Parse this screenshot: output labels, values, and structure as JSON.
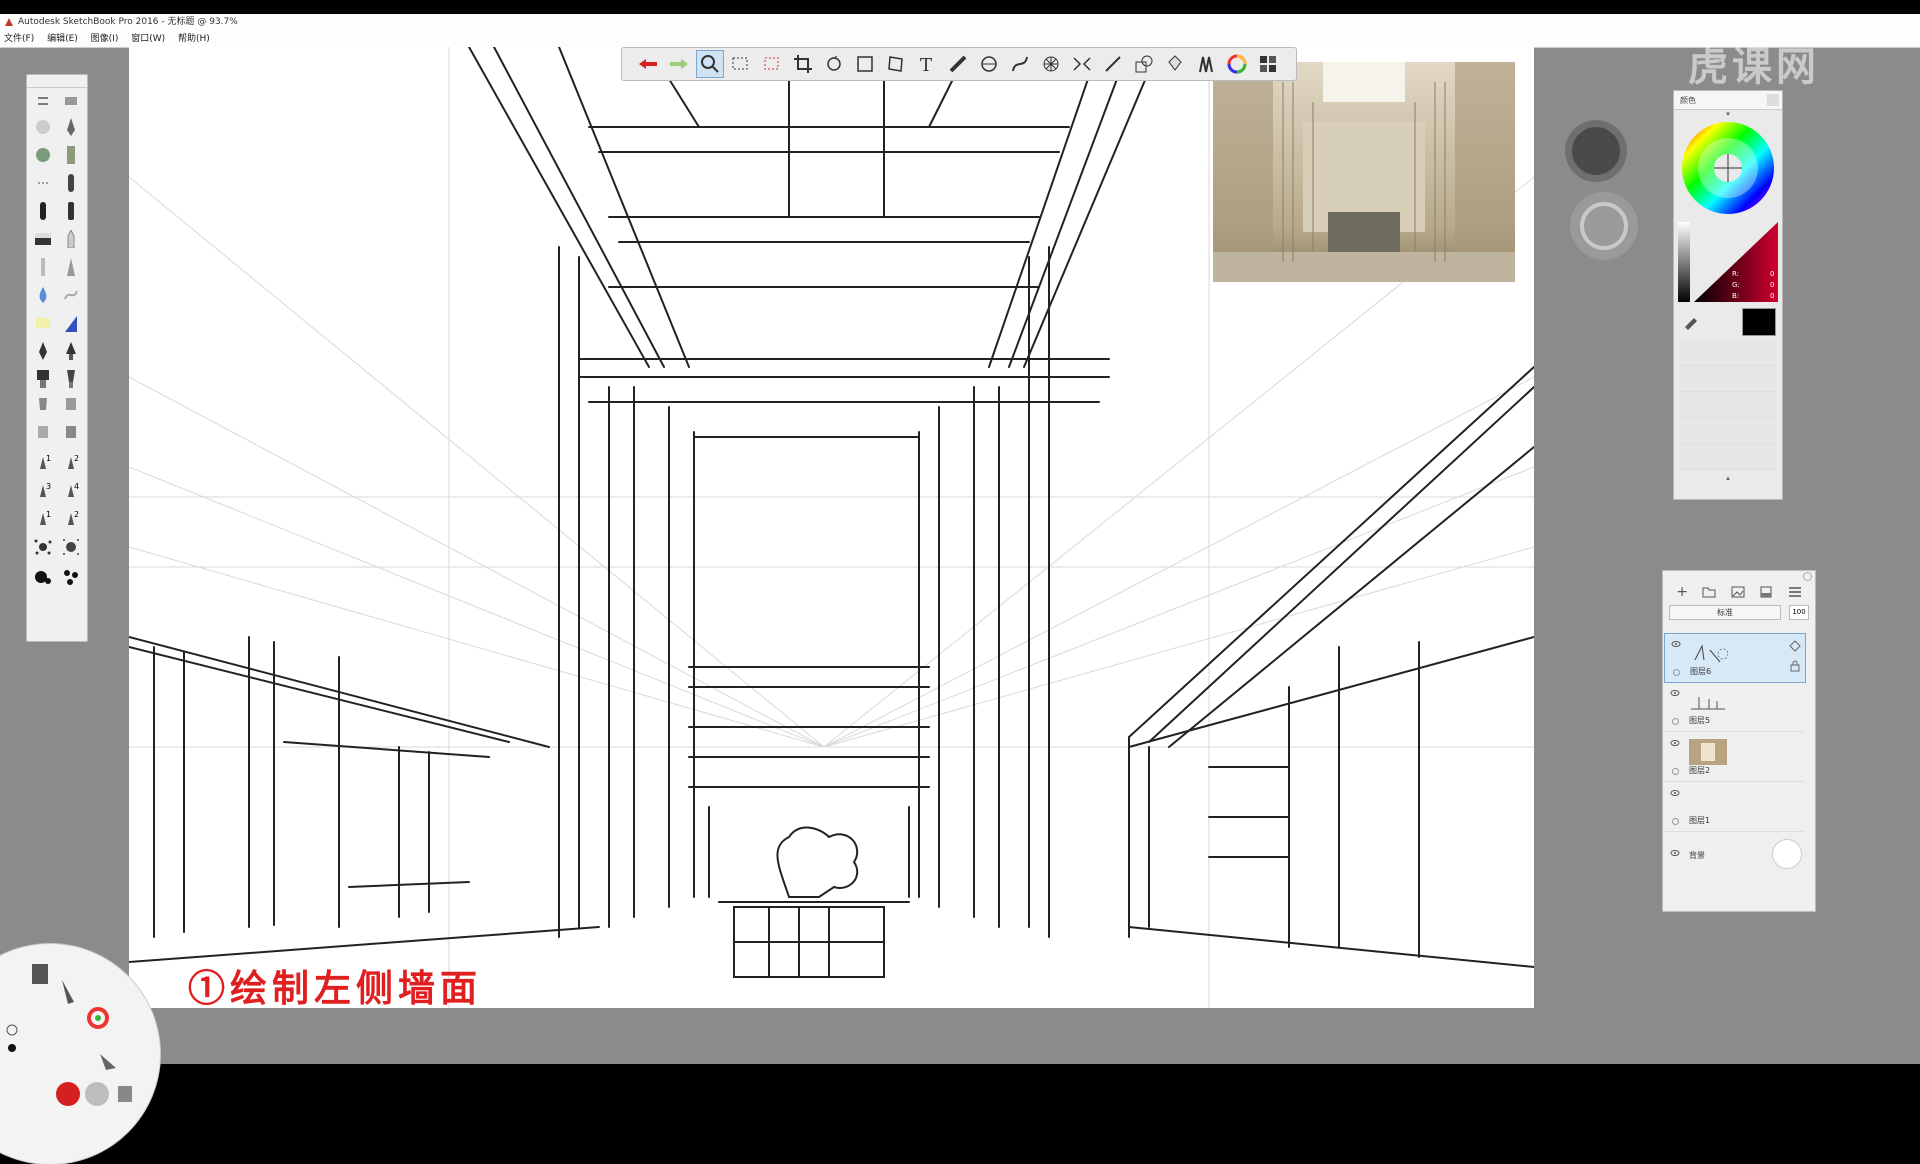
{
  "window": {
    "title": "Autodesk SketchBook Pro 2016 - 无标题 @ 93.7%"
  },
  "menu": {
    "items": [
      "文件(F)",
      "编辑(E)",
      "图像(I)",
      "窗口(W)",
      "帮助(H)"
    ]
  },
  "toolbar": {
    "tools": [
      "undo-icon",
      "redo-icon",
      "zoom-icon",
      "rect-select-icon",
      "lasso-select-icon",
      "crop-icon",
      "rotate-icon",
      "transform-icon",
      "distort-icon",
      "text-icon",
      "ruler-icon",
      "ellipse-icon",
      "french-curve-icon",
      "perspective-icon",
      "symmetry-icon",
      "line-icon",
      "shape-icon",
      "fill-icon",
      "brush-palette-icon",
      "color-wheel-icon",
      "copic-library-icon"
    ],
    "active_tool": "zoom-icon"
  },
  "color_panel": {
    "title": "颜色",
    "rgb": {
      "r_label": "R:",
      "g_label": "G:",
      "b_label": "B:",
      "r": "0",
      "g": "0",
      "b": "0"
    },
    "current_color": "#000000"
  },
  "layers_panel": {
    "blend_mode": "标准",
    "opacity": "100",
    "layers": [
      {
        "name": "图层6",
        "selected": true
      },
      {
        "name": "图层5",
        "selected": false
      },
      {
        "name": "图层2",
        "selected": false
      },
      {
        "name": "图层1",
        "selected": false
      },
      {
        "name": "背景",
        "selected": false
      }
    ]
  },
  "brush_numbers": [
    "1",
    "2",
    "3",
    "4",
    "1",
    "2"
  ],
  "caption": "①绘制左侧墙面",
  "watermark": "虎课网",
  "colors": {
    "canvas": "#ffffff",
    "workspace": "#8b8b8b",
    "caption": "#e02020",
    "accent": "#7aa7d0"
  }
}
